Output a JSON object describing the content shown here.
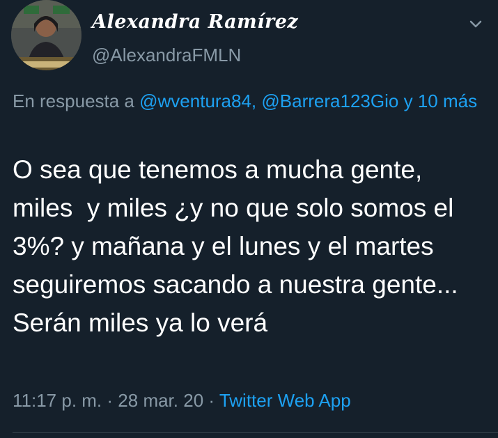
{
  "author": {
    "display_name": "Alexandra Ramírez",
    "handle": "@AlexandraFMLN",
    "avatar_icon": "profile-photo"
  },
  "menu": {
    "icon": "chevron-down-icon"
  },
  "reply": {
    "prefix": "En respuesta a",
    "mention1": "@wventura84,",
    "mention2": "@Barrera123Gio",
    "connector": "y",
    "more": "10 más"
  },
  "tweet": {
    "text": "O sea que tenemos a mucha gente, miles  y miles ¿y no que solo somos el 3%? y mañana y el lunes y el martes seguiremos sacando a nuestra gente... Serán miles ya lo verá"
  },
  "meta": {
    "time": "11:17 p. m.",
    "sep1": "·",
    "date": "28 mar. 20",
    "sep2": "·",
    "source": "Twitter Web App"
  },
  "colors": {
    "background": "#15202b",
    "text": "#ffffff",
    "secondary": "#8899a6",
    "link": "#1da1f2"
  }
}
